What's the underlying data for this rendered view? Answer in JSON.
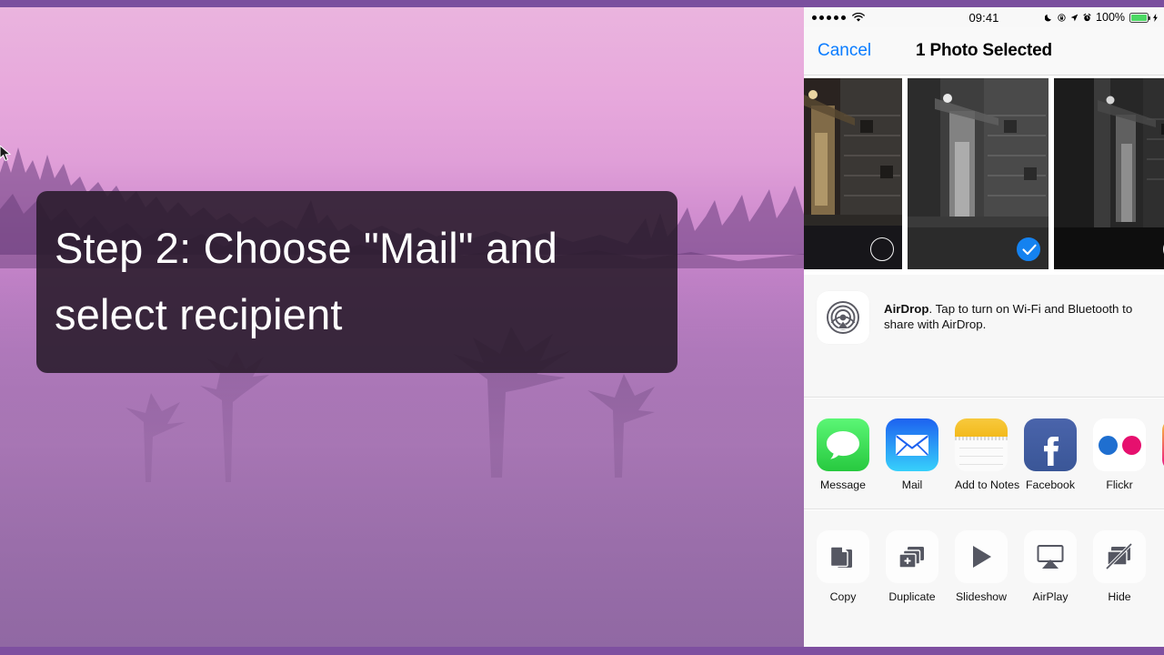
{
  "video": {
    "caption_lines": [
      "Step 2: Choose \"Mail\" and",
      "select recipient"
    ],
    "cursor_icon": "mouse-pointer"
  },
  "phone": {
    "status_bar": {
      "signal_dots": 5,
      "wifi_icon": "wifi-icon",
      "time": "09:41",
      "do_not_disturb_icon": "moon-icon",
      "rotation_lock_icon": "rotation-lock-icon",
      "location_icon": "location-arrow-icon",
      "alarm_icon": "alarm-clock-icon",
      "battery_percent": "100%",
      "battery_icon": "battery-full-icon",
      "charging_icon": "lightning-bolt-icon",
      "battery_color": "#4cd964"
    },
    "nav_bar": {
      "cancel_label": "Cancel",
      "title": "1 Photo Selected",
      "accent_color": "#0a7cff"
    },
    "photo_strip": {
      "photos": [
        {
          "name": "alley-photo-1",
          "selected": false,
          "check_icon": "empty-circle-icon"
        },
        {
          "name": "alley-photo-2",
          "selected": true,
          "check_icon": "checkmark-circle-icon"
        },
        {
          "name": "alley-photo-3",
          "selected": false,
          "check_icon": "empty-circle-icon"
        }
      ],
      "selected_color": "#1482f0"
    },
    "airdrop": {
      "icon": "airdrop-icon",
      "title": "AirDrop",
      "description": ". Tap to turn on Wi-Fi and Bluetooth to share with AirDrop."
    },
    "share_apps": [
      {
        "label": "Message",
        "icon": "message-bubble-icon"
      },
      {
        "label": "Mail",
        "icon": "mail-envelope-icon"
      },
      {
        "label": "Add to Notes",
        "icon": "notes-icon"
      },
      {
        "label": "Facebook",
        "icon": "facebook-icon"
      },
      {
        "label": "Flickr",
        "icon": "flickr-icon"
      },
      {
        "label": "",
        "icon": "instagram-icon"
      }
    ],
    "actions": [
      {
        "label": "Copy",
        "icon": "copy-icon"
      },
      {
        "label": "Duplicate",
        "icon": "duplicate-icon"
      },
      {
        "label": "Slideshow",
        "icon": "play-icon"
      },
      {
        "label": "AirPlay",
        "icon": "airplay-icon"
      },
      {
        "label": "Hide",
        "icon": "hide-icon"
      }
    ]
  }
}
